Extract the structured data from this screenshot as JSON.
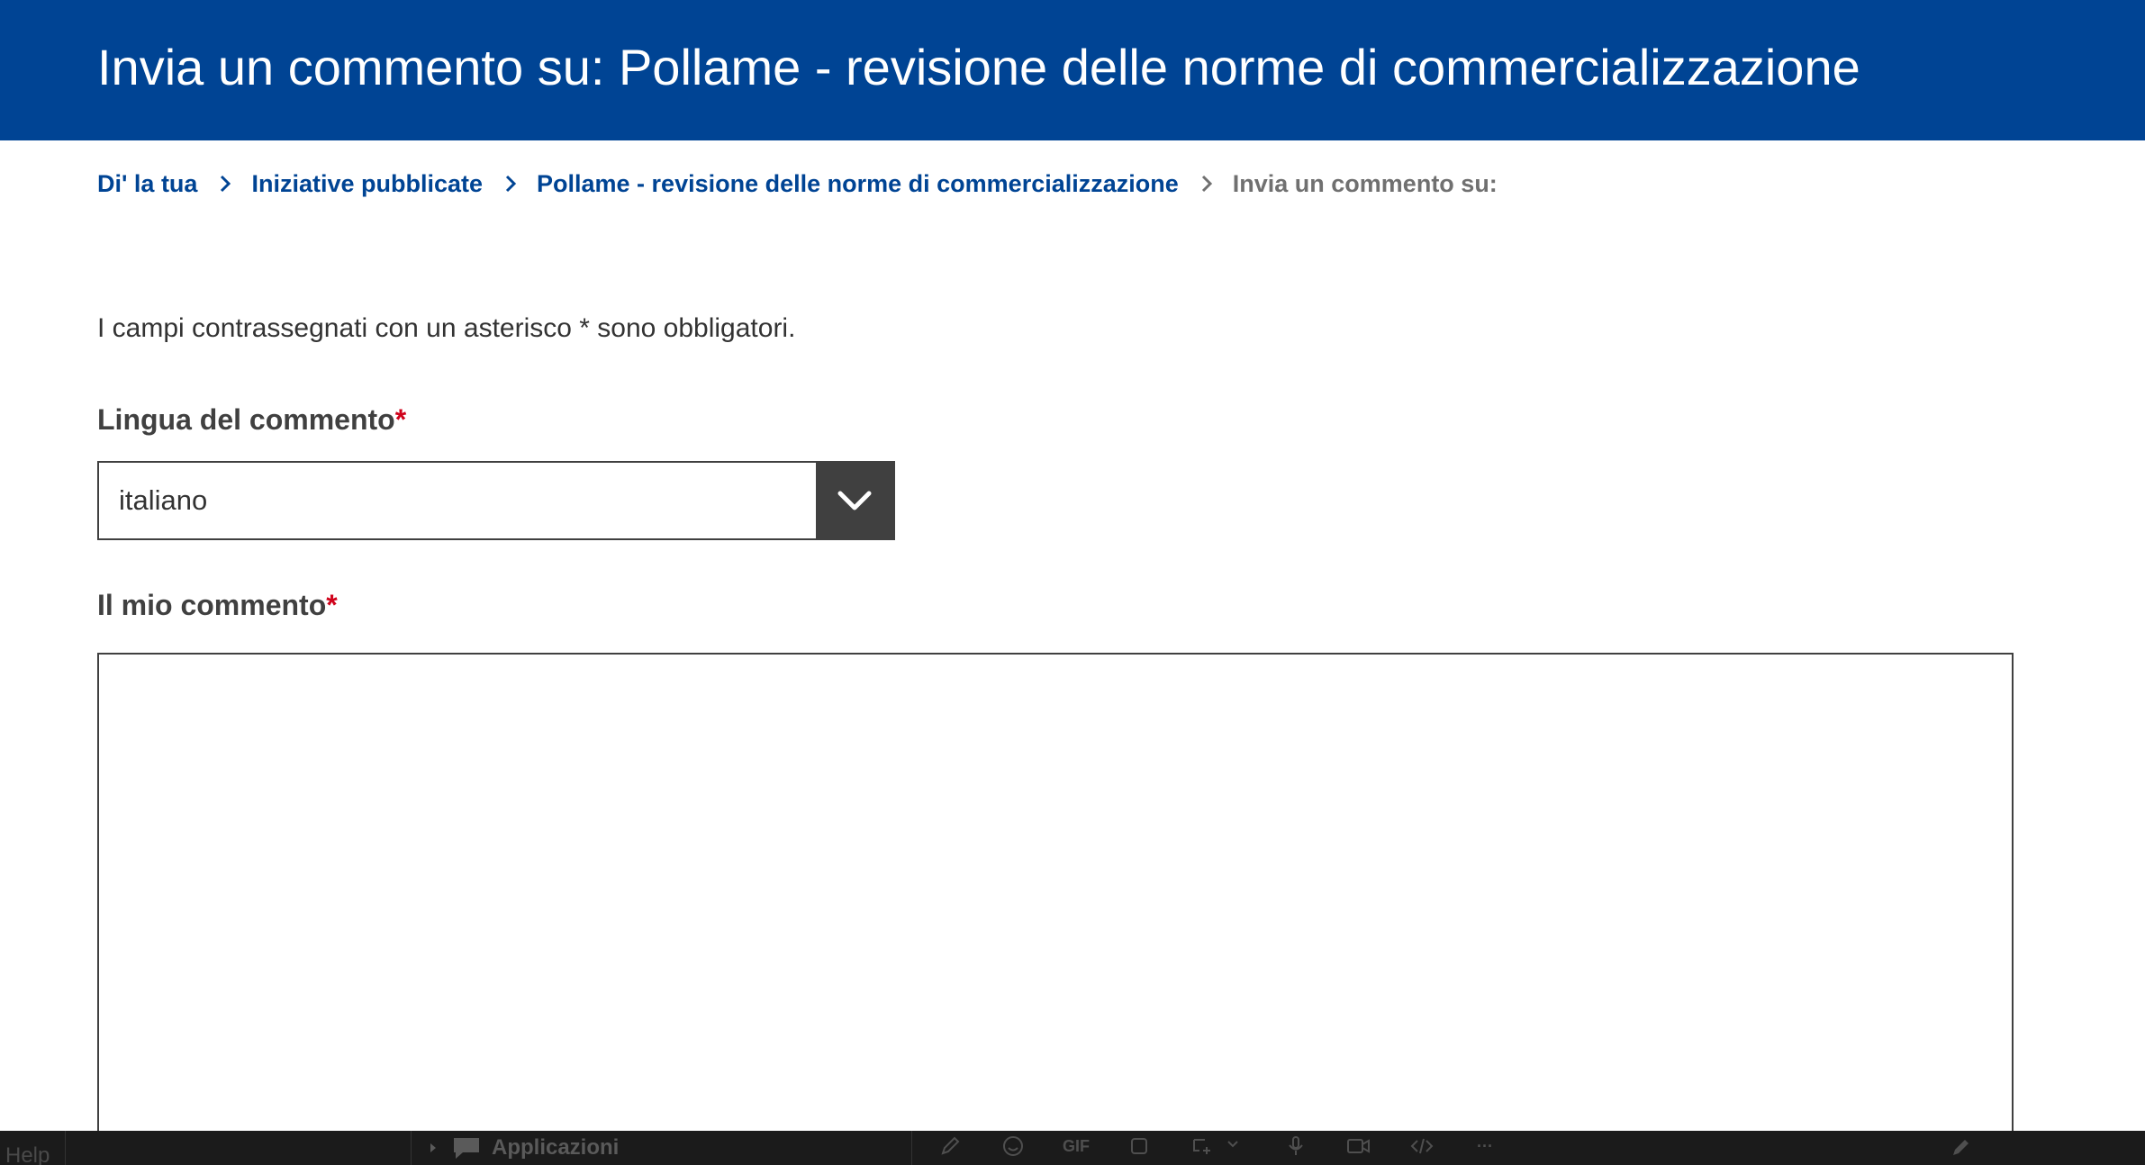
{
  "header": {
    "title": "Invia un commento su: Pollame - revisione delle norme di commercializzazione"
  },
  "breadcrumb": {
    "items": [
      {
        "label": "Di' la tua"
      },
      {
        "label": "Iniziative pubblicate"
      },
      {
        "label": "Pollame - revisione delle norme di commercializzazione"
      }
    ],
    "current": "Invia un commento su:"
  },
  "form": {
    "required_note": "I campi contrassegnati con un asterisco * sono obbligatori.",
    "required_marker": "*",
    "language": {
      "label": "Lingua del commento",
      "value": "italiano"
    },
    "comment": {
      "label": "Il mio commento",
      "value": ""
    }
  },
  "taskbar": {
    "help_label": "Help",
    "apps_label": "Applicazioni",
    "gif_label": "GIF",
    "more_label": "···"
  },
  "colors": {
    "header_bg": "#004494",
    "link": "#004494",
    "required": "#d0021b",
    "select_button": "#404040"
  }
}
